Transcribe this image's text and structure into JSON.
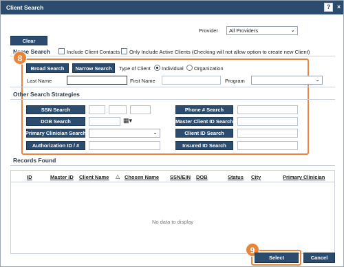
{
  "window": {
    "title": "Client Search",
    "help_icon": "help-icon",
    "close_icon": "close-icon"
  },
  "clear_label": "Clear",
  "provider": {
    "label": "Provider",
    "value": "All Providers"
  },
  "name_search": {
    "title": "Name Search",
    "include_contacts": "Include Client Contacts",
    "only_active": "Only Include Active Clients (Checking will not allow option to create new Client)",
    "broad_search": "Broad Search",
    "narrow_search": "Narrow Search",
    "type_label": "Type of Client",
    "type_individual": "Individual",
    "type_organization": "Organization",
    "last_name": "Last Name",
    "first_name": "First Name",
    "program": "Program"
  },
  "other": {
    "title": "Other Search Strategies",
    "ssn_search": "SSN Search",
    "dob_search": "DOB Search",
    "primary_clinician_search": "Primary Clinician Search",
    "authorization_id": "Authorization ID / #",
    "phone_search": "Phone # Search",
    "master_client_id_search": "Master Client ID Search",
    "client_id_search": "Client ID Search",
    "insured_id_search": "Insured ID Search"
  },
  "records": {
    "title": "Records Found",
    "columns": [
      "ID",
      "Master ID",
      "Client Name",
      "Chosen Name",
      "SSN/EIN",
      "DOB",
      "Status",
      "City",
      "Primary Clinician"
    ],
    "empty_text": "No data to display"
  },
  "callouts": {
    "eight": "8",
    "nine": "9"
  },
  "footer": {
    "select": "Select",
    "cancel": "Cancel"
  },
  "colors": {
    "navy": "#2b4c6f",
    "accent": "#e9843a"
  }
}
